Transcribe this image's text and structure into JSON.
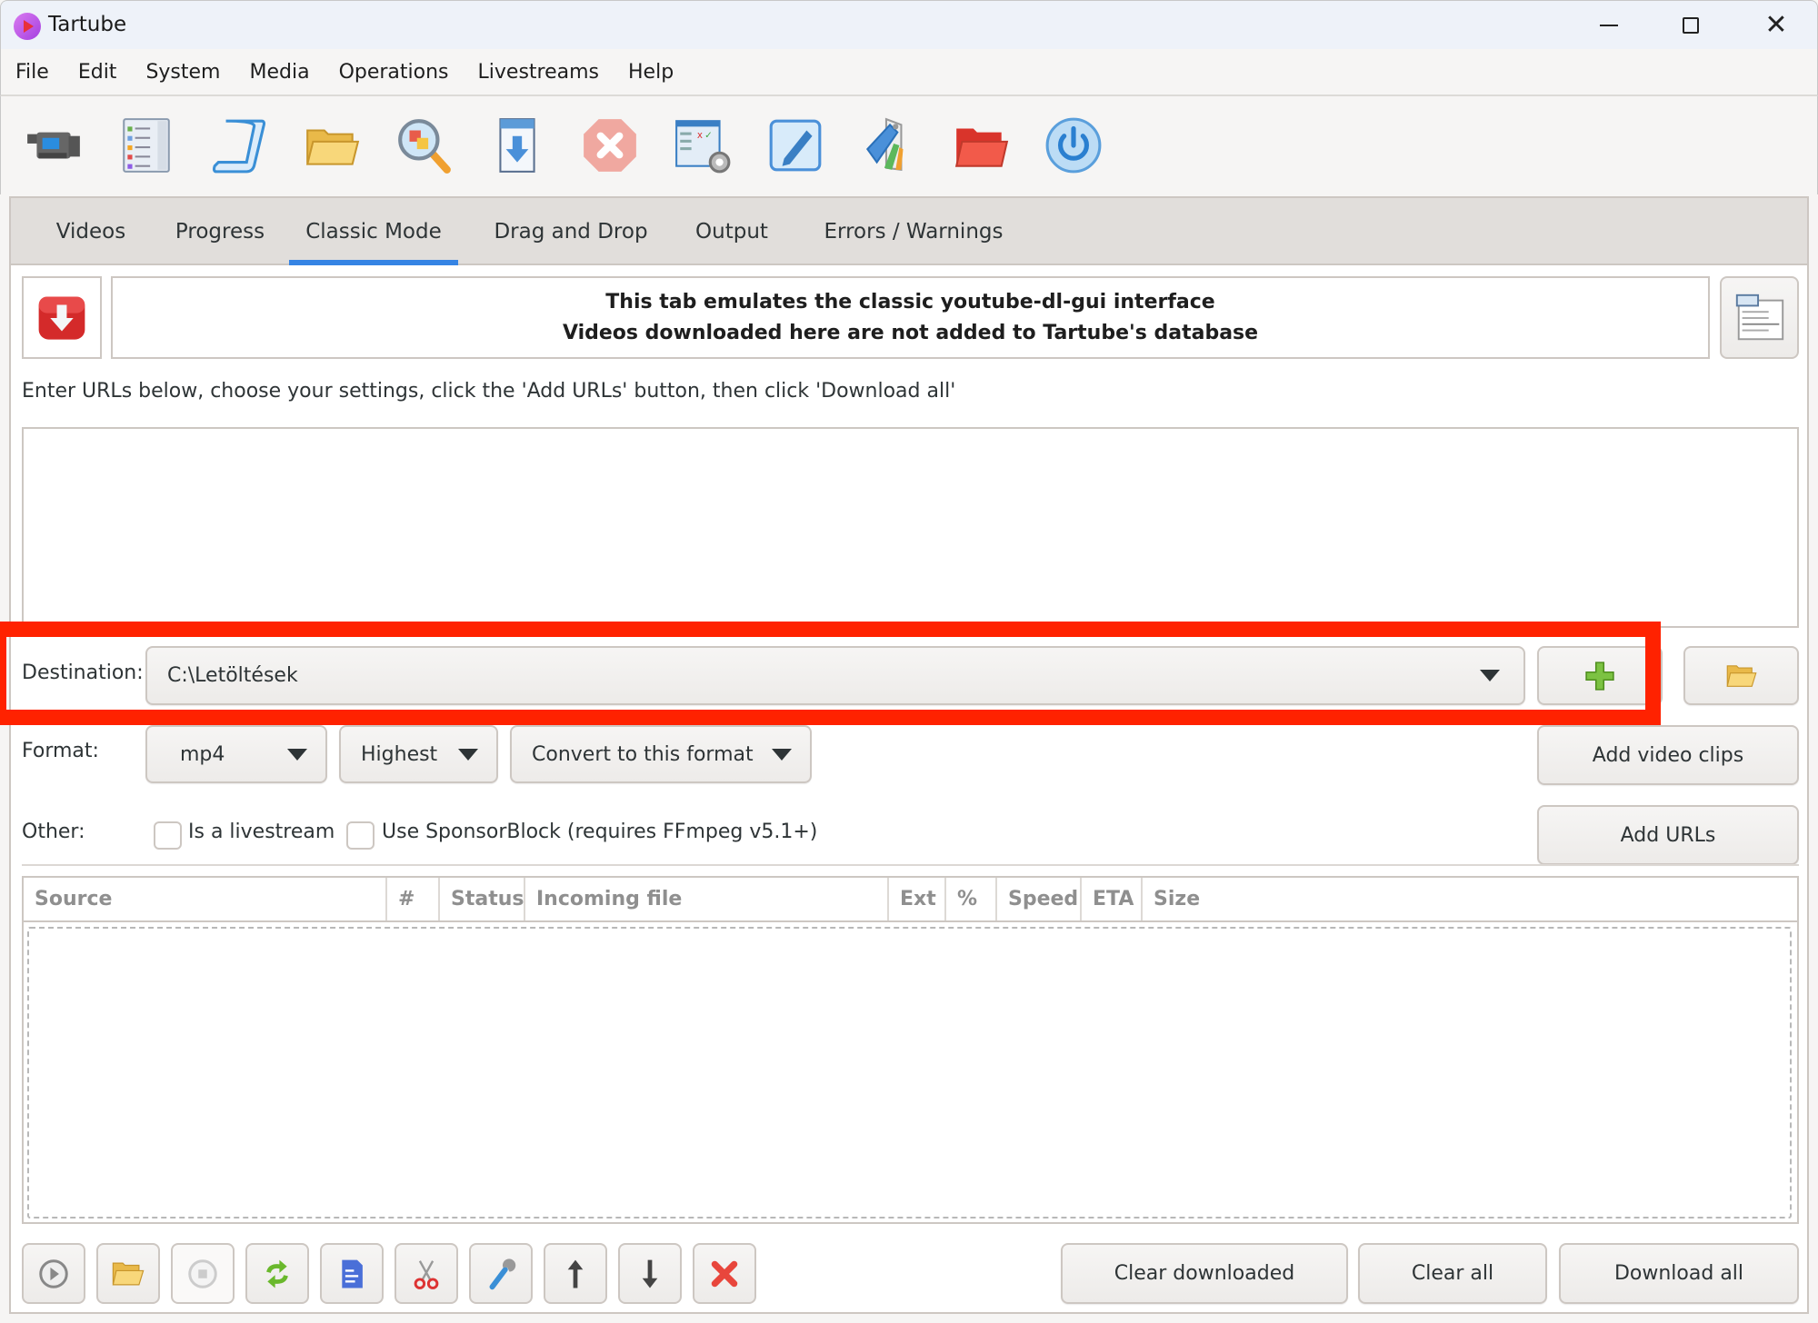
{
  "window": {
    "title": "Tartube",
    "controls": {
      "minimize": "minimize",
      "maximize": "maximize",
      "close": "close"
    }
  },
  "menu": [
    "File",
    "Edit",
    "System",
    "Media",
    "Operations",
    "Livestreams",
    "Help"
  ],
  "toolbar": [
    {
      "icon": "video-camera-icon",
      "tooltip": "Add videos"
    },
    {
      "icon": "channel-list-icon",
      "tooltip": "Add channel"
    },
    {
      "icon": "playlist-scroll-icon",
      "tooltip": "Add playlist"
    },
    {
      "icon": "folder-icon",
      "tooltip": "Add folder"
    },
    {
      "icon": "check-all-icon",
      "tooltip": "Check all"
    },
    {
      "icon": "download-all-icon",
      "tooltip": "Download all"
    },
    {
      "icon": "stop-icon",
      "tooltip": "Stop"
    },
    {
      "icon": "preferences-icon",
      "tooltip": "Preferences"
    },
    {
      "icon": "edit-icon",
      "tooltip": "Edit"
    },
    {
      "icon": "tags-icon",
      "tooltip": "Tags"
    },
    {
      "icon": "red-folder-icon",
      "tooltip": "Open folder"
    },
    {
      "icon": "power-icon",
      "tooltip": "Quit"
    }
  ],
  "tabs": [
    {
      "label": "Videos",
      "active": false
    },
    {
      "label": "Progress",
      "active": false
    },
    {
      "label": "Classic Mode",
      "active": true
    },
    {
      "label": "Drag and Drop",
      "active": false
    },
    {
      "label": "Output",
      "active": false
    },
    {
      "label": "Errors / Warnings",
      "active": false
    }
  ],
  "classic": {
    "banner_line1": "This tab emulates the classic youtube-dl-gui interface",
    "banner_line2": "Videos downloaded here are not added to Tartube's database",
    "instructions": "Enter URLs below, choose your settings, click the 'Add URLs' button, then click 'Download all'",
    "url_text": "",
    "destination_label": "Destination:",
    "destination_value": "C:\\Letöltések",
    "format_label": "Format:",
    "format_value": "mp4",
    "quality_value": "Highest",
    "convert_value": "Convert to this format",
    "add_clips_label": "Add video clips",
    "other_label": "Other:",
    "livestream_label": "Is a livestream",
    "livestream_checked": false,
    "sponsorblock_label": "Use SponsorBlock (requires FFmpeg v5.1+)",
    "sponsorblock_checked": false,
    "add_urls_label": "Add URLs"
  },
  "table": {
    "columns": [
      "Source",
      "#",
      "Status",
      "Incoming file",
      "Ext",
      "%",
      "Speed",
      "ETA",
      "Size"
    ],
    "rows": []
  },
  "bottom": {
    "icon_buttons": [
      "play-icon",
      "folder-icon",
      "stop-icon",
      "refresh-icon",
      "document-icon",
      "scissors-icon",
      "wrench-icon",
      "arrow-up-icon",
      "arrow-down-icon",
      "delete-icon"
    ],
    "clear_downloaded": "Clear downloaded",
    "clear_all": "Clear all",
    "download_all": "Download all"
  },
  "colors": {
    "accent": "#3584e4",
    "highlight": "#ff2200"
  }
}
